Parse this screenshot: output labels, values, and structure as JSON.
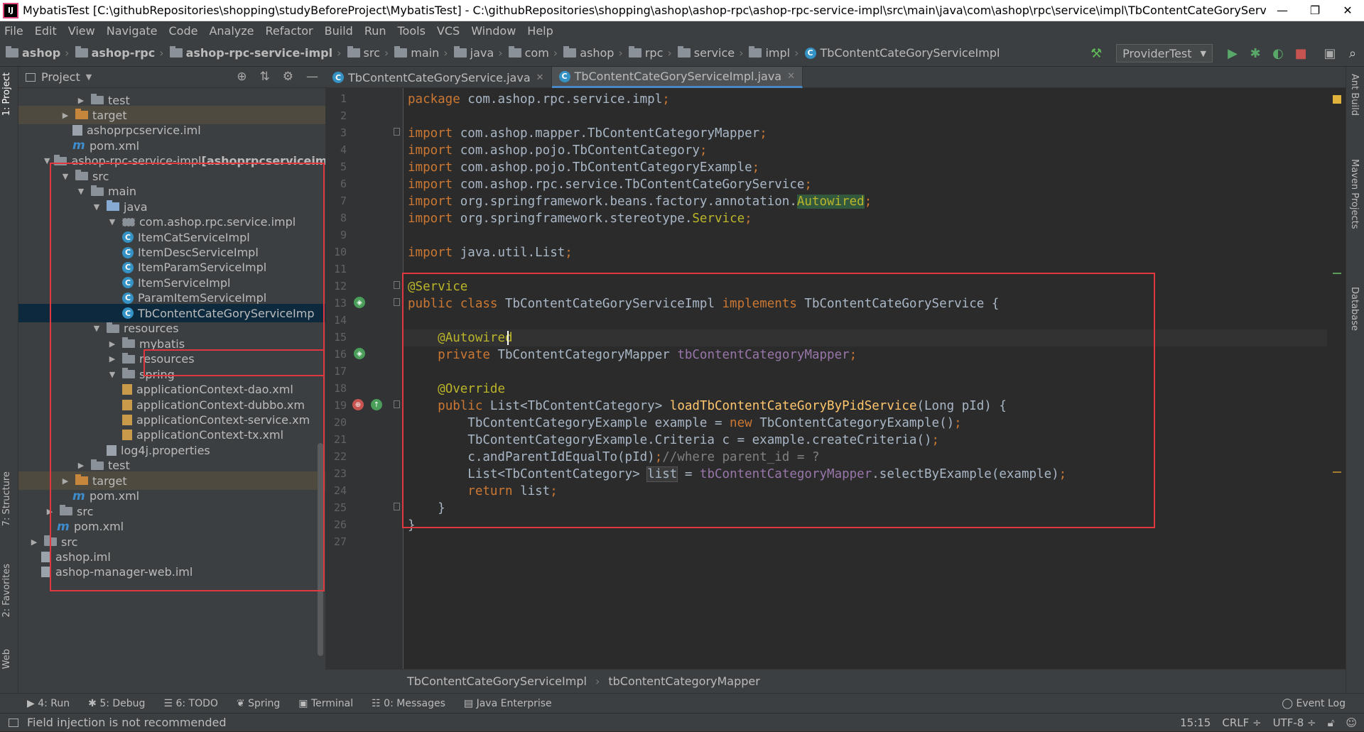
{
  "window": {
    "title": "MybatisTest [C:\\githubRepositories\\shopping\\studyBeforeProject\\MybatisTest] - C:\\githubRepositories\\shopping\\ashop\\ashop-rpc\\ashop-rpc-service-impl\\src\\main\\java\\com\\ashop\\rpc\\service\\impl\\TbContentCateGoryServiceImpl.ja...",
    "minimize": "—",
    "restore": "❐",
    "close": "✕"
  },
  "menu": [
    "File",
    "Edit",
    "View",
    "Navigate",
    "Code",
    "Analyze",
    "Refactor",
    "Build",
    "Run",
    "Tools",
    "VCS",
    "Window",
    "Help"
  ],
  "breadcrumbs": [
    "ashop",
    "ashop-rpc",
    "ashop-rpc-service-impl",
    "src",
    "main",
    "java",
    "com",
    "ashop",
    "rpc",
    "service",
    "impl",
    "TbContentCateGoryServiceImpl"
  ],
  "run_config": "ProviderTest",
  "colors": {
    "accent": "#4a88c7",
    "highlight_border": "#e0383e",
    "selection": "#0d293e"
  },
  "left_tabs": [
    "1: Project",
    "7: Structure",
    "2: Favorites",
    "Web"
  ],
  "right_tabs": [
    "Ant Build",
    "Maven Projects",
    "Database"
  ],
  "project": {
    "title": "Project",
    "tree": [
      {
        "label": "test",
        "icon": "folder",
        "indent": 80,
        "arrow": "▶"
      },
      {
        "label": "target",
        "icon": "folderorange",
        "indent": 58,
        "arrow": "▶",
        "dim": true
      },
      {
        "label": "ashoprpcservice.iml",
        "icon": "iml",
        "indent": 76,
        "arrow": ""
      },
      {
        "label": "pom.xml",
        "icon": "mvn",
        "indent": 76,
        "arrow": ""
      },
      {
        "label": "ashop-rpc-service-impl",
        "bold_suffix": " [ashoprpcserviceimpl",
        "icon": "folder",
        "indent": 36,
        "arrow": "▼"
      },
      {
        "label": "src",
        "icon": "folder",
        "indent": 58,
        "arrow": "▼"
      },
      {
        "label": "main",
        "icon": "folder",
        "indent": 80,
        "arrow": "▼"
      },
      {
        "label": "java",
        "icon": "folderblue",
        "indent": 102,
        "arrow": "▼"
      },
      {
        "label": "com.ashop.rpc.service.impl",
        "icon": "pkg",
        "indent": 124,
        "arrow": "▼"
      },
      {
        "label": "ItemCatServiceImpl",
        "icon": "cls",
        "indent": 146,
        "arrow": ""
      },
      {
        "label": "ItemDescServiceImpl",
        "icon": "cls",
        "indent": 146,
        "arrow": ""
      },
      {
        "label": "ItemParamServiceImpl",
        "icon": "cls",
        "indent": 146,
        "arrow": ""
      },
      {
        "label": "ItemServiceImpl",
        "icon": "cls",
        "indent": 146,
        "arrow": ""
      },
      {
        "label": "ParamItemServiceImpl",
        "icon": "cls",
        "indent": 146,
        "arrow": ""
      },
      {
        "label": "TbContentCateGoryServiceImp",
        "icon": "cls",
        "indent": 146,
        "arrow": "",
        "selected": true
      },
      {
        "label": "resources",
        "icon": "folder",
        "indent": 102,
        "arrow": "▼"
      },
      {
        "label": "mybatis",
        "icon": "folder",
        "indent": 124,
        "arrow": "▶"
      },
      {
        "label": "resources",
        "icon": "folder",
        "indent": 124,
        "arrow": "▶"
      },
      {
        "label": "spring",
        "icon": "folder",
        "indent": 124,
        "arrow": "▼"
      },
      {
        "label": "applicationContext-dao.xml",
        "icon": "xml",
        "indent": 146,
        "arrow": ""
      },
      {
        "label": "applicationContext-dubbo.xm",
        "icon": "xml",
        "indent": 146,
        "arrow": ""
      },
      {
        "label": "applicationContext-service.xm",
        "icon": "xml",
        "indent": 146,
        "arrow": ""
      },
      {
        "label": "applicationContext-tx.xml",
        "icon": "xml",
        "indent": 146,
        "arrow": ""
      },
      {
        "label": "log4j.properties",
        "icon": "prop",
        "indent": 124,
        "arrow": ""
      },
      {
        "label": "test",
        "icon": "folder",
        "indent": 80,
        "arrow": "▶"
      },
      {
        "label": "target",
        "icon": "folderorange",
        "indent": 58,
        "arrow": "▶",
        "dim": true
      },
      {
        "label": "pom.xml",
        "icon": "mvn",
        "indent": 76,
        "arrow": ""
      },
      {
        "label": "src",
        "icon": "folder",
        "indent": 36,
        "arrow": "▶"
      },
      {
        "label": "pom.xml",
        "icon": "mvn",
        "indent": 54,
        "arrow": ""
      },
      {
        "label": "src",
        "icon": "folder",
        "indent": 14,
        "arrow": "▶"
      },
      {
        "label": "ashop.iml",
        "icon": "iml",
        "indent": 32,
        "arrow": ""
      },
      {
        "label": "ashop-manager-web.iml",
        "icon": "iml",
        "indent": 32,
        "arrow": ""
      }
    ]
  },
  "editor_tabs": [
    {
      "label": "TbContentCateGoryService.java",
      "active": false
    },
    {
      "label": "TbContentCateGoryServiceImpl.java",
      "active": true
    }
  ],
  "code_lines": [
    [
      [
        "k",
        "package "
      ],
      [
        "",
        "com.ashop.rpc.service.impl"
      ],
      [
        "k",
        ";"
      ]
    ],
    [],
    [
      [
        "k",
        "import "
      ],
      [
        "",
        "com.ashop.mapper.TbContentCategoryMapper"
      ],
      [
        "k",
        ";"
      ]
    ],
    [
      [
        "k",
        "import "
      ],
      [
        "",
        "com.ashop.pojo.TbContentCategory"
      ],
      [
        "k",
        ";"
      ]
    ],
    [
      [
        "k",
        "import "
      ],
      [
        "",
        "com.ashop.pojo.TbContentCategoryExample"
      ],
      [
        "k",
        ";"
      ]
    ],
    [
      [
        "k",
        "import "
      ],
      [
        "",
        "com.ashop.rpc.service.TbContentCateGoryService"
      ],
      [
        "k",
        ";"
      ]
    ],
    [
      [
        "k",
        "import "
      ],
      [
        "",
        "org.springframework.beans.factory.annotation."
      ],
      [
        "hl-aw",
        "Autowired"
      ],
      [
        "k",
        ";"
      ]
    ],
    [
      [
        "k",
        "import "
      ],
      [
        "",
        "org.springframework.stereotype."
      ],
      [
        "an",
        "Service"
      ],
      [
        "k",
        ";"
      ]
    ],
    [],
    [
      [
        "k",
        "import "
      ],
      [
        "",
        "java.util.List"
      ],
      [
        "k",
        ";"
      ]
    ],
    [],
    [
      [
        "an",
        "@Service"
      ]
    ],
    [
      [
        "k",
        "public class "
      ],
      [
        "",
        "TbContentCateGoryServiceImpl "
      ],
      [
        "k",
        "implements "
      ],
      [
        "",
        "TbContentCateGoryService {"
      ]
    ],
    [],
    [
      [
        "",
        "    "
      ],
      [
        "an",
        "@Autowired"
      ]
    ],
    [
      [
        "",
        "    "
      ],
      [
        "k",
        "private "
      ],
      [
        "",
        "TbContentCategoryMapper "
      ],
      [
        "fd",
        "tbContentCategoryMapper"
      ],
      [
        "k",
        ";"
      ]
    ],
    [],
    [
      [
        "",
        "    "
      ],
      [
        "an",
        "@Override"
      ]
    ],
    [
      [
        "",
        "    "
      ],
      [
        "k",
        "public "
      ],
      [
        "",
        "List<TbContentCategory> "
      ],
      [
        "fn",
        "loadTbContentCateGoryByPidService"
      ],
      [
        "",
        "(Long pId) {"
      ]
    ],
    [
      [
        "",
        "        TbContentCategoryExample example = "
      ],
      [
        "k",
        "new "
      ],
      [
        "",
        "TbContentCategoryExample()"
      ],
      [
        "k",
        ";"
      ]
    ],
    [
      [
        "",
        "        TbContentCategoryExample.Criteria c = example.createCriteria()"
      ],
      [
        "k",
        ";"
      ]
    ],
    [
      [
        "",
        "        c.andParentIdEqualTo(pId)"
      ],
      [
        "k",
        ";"
      ],
      [
        "cm",
        "//where parent_id = ?"
      ]
    ],
    [
      [
        "",
        "        List<TbContentCategory> "
      ],
      [
        "hl-list",
        "list"
      ],
      [
        "",
        " = "
      ],
      [
        "fd",
        "tbContentCategoryMapper"
      ],
      [
        "",
        ".selectByExample(example)"
      ],
      [
        "k",
        ";"
      ]
    ],
    [
      [
        "",
        "        "
      ],
      [
        "k",
        "return "
      ],
      [
        "",
        "list"
      ],
      [
        "k",
        ";"
      ]
    ],
    [
      [
        "",
        "    }"
      ]
    ],
    [
      [
        "",
        "}"
      ]
    ],
    []
  ],
  "code_breadcrumb": [
    "TbContentCateGoryServiceImpl",
    "tbContentCategoryMapper"
  ],
  "bottom_tabs": [
    "4: Run",
    "5: Debug",
    "6: TODO",
    "Spring",
    "Terminal",
    "0: Messages",
    "Java Enterprise"
  ],
  "event_log": "Event Log",
  "status": {
    "message": "Field injection is not recommended",
    "position": "15:15",
    "line_sep": "CRLF ÷",
    "encoding": "UTF-8 ÷"
  }
}
